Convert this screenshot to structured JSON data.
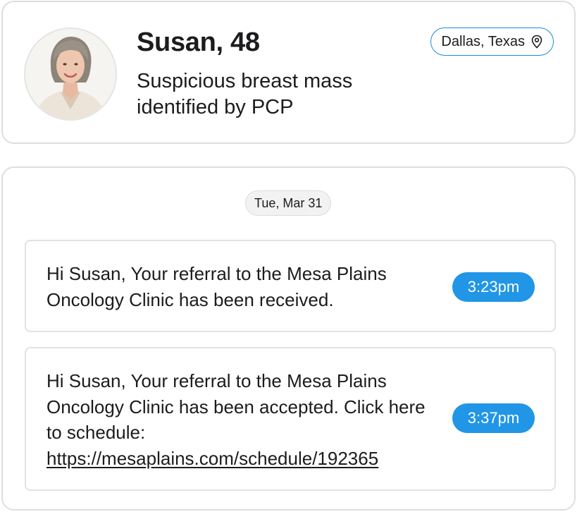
{
  "profile": {
    "name_age": "Susan, 48",
    "description": "Suspicious breast mass identified by PCP",
    "location": "Dallas, Texas",
    "location_icon": "map-pin-icon"
  },
  "conversation": {
    "date": "Tue, Mar 31",
    "messages": [
      {
        "text": "Hi Susan, Your referral to the Mesa Plains Oncology Clinic has been received.",
        "time": "3:23pm"
      },
      {
        "text_before_link": "Hi Susan, Your referral to the Mesa Plains Oncology Clinic has been accepted. Click here to schedule: ",
        "link": "https://mesaplains.com/schedule/192365",
        "time": "3:37pm"
      }
    ]
  },
  "colors": {
    "accent": "#2196e6",
    "pill_border": "#1e8ad8",
    "card_border": "#dedede",
    "text": "#1c1c1e"
  }
}
